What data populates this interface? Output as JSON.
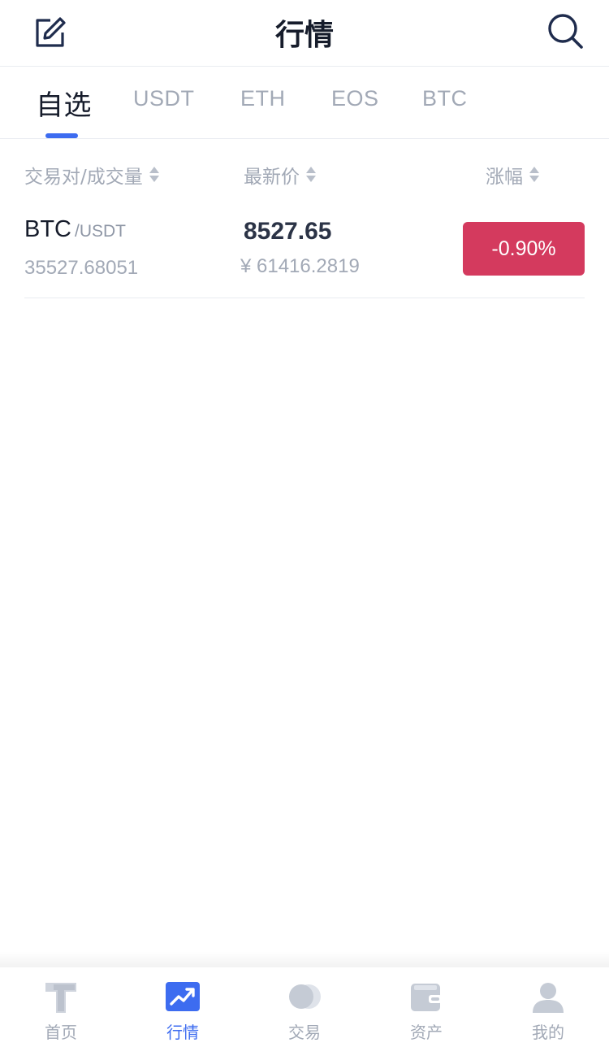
{
  "header": {
    "title": "行情",
    "edit_icon": "edit-icon",
    "search_icon": "search-icon"
  },
  "tabs": [
    {
      "label": "自选",
      "active": true
    },
    {
      "label": "USDT",
      "active": false
    },
    {
      "label": "ETH",
      "active": false
    },
    {
      "label": "EOS",
      "active": false
    },
    {
      "label": "BTC",
      "active": false
    }
  ],
  "columns": {
    "pair_volume": "交易对/成交量",
    "latest_price": "最新价",
    "change": "涨幅"
  },
  "rows": [
    {
      "base": "BTC",
      "quote": "/USDT",
      "volume": "35527.68051",
      "price": "8527.65",
      "cny": "¥ 61416.2819",
      "change": "-0.90%"
    }
  ],
  "bottom_nav": [
    {
      "label": "首页",
      "icon": "home-icon",
      "active": false
    },
    {
      "label": "行情",
      "icon": "market-chart-icon",
      "active": true
    },
    {
      "label": "交易",
      "icon": "trade-icon",
      "active": false
    },
    {
      "label": "资产",
      "icon": "wallet-icon",
      "active": false
    },
    {
      "label": "我的",
      "icon": "profile-icon",
      "active": false
    }
  ],
  "colors": {
    "accent": "#3d6cf0",
    "down": "#d43a5e",
    "muted": "#a2a9b6"
  }
}
